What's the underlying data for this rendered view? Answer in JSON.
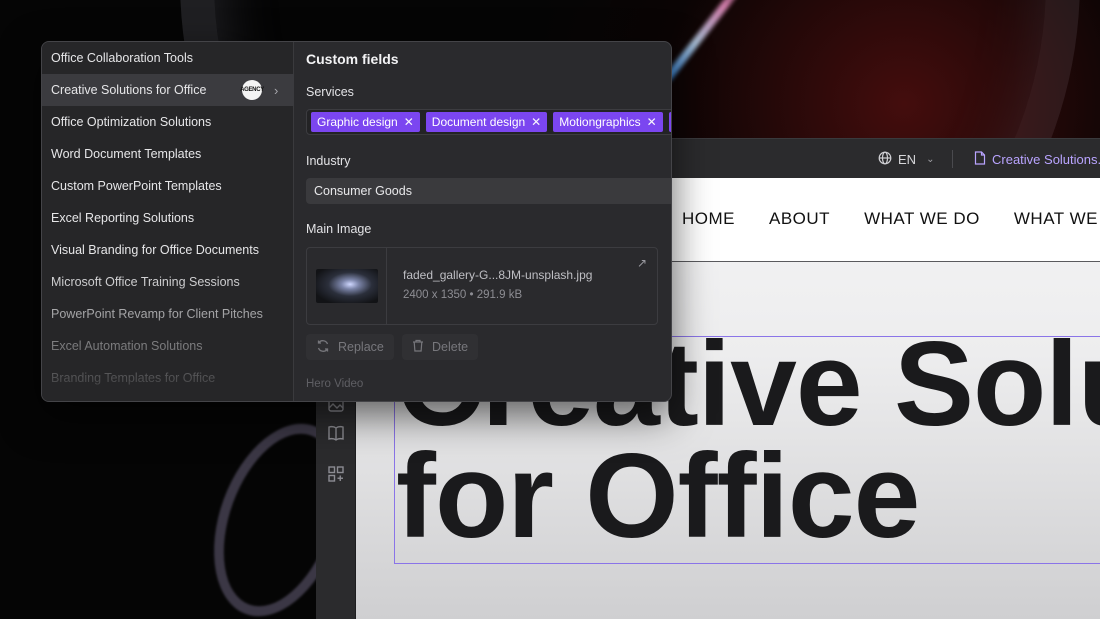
{
  "panel": {
    "list": [
      {
        "label": "Office Collaboration Tools"
      },
      {
        "label": "Creative Solutions for Office",
        "badge": "AGENCY"
      },
      {
        "label": "Office Optimization Solutions"
      },
      {
        "label": "Word Document Templates"
      },
      {
        "label": "Custom PowerPoint Templates"
      },
      {
        "label": "Excel Reporting Solutions"
      },
      {
        "label": "Visual Branding for Office Documents"
      },
      {
        "label": "Microsoft Office Training Sessions"
      },
      {
        "label": "PowerPoint Revamp for Client Pitches"
      },
      {
        "label": "Excel Automation Solutions"
      },
      {
        "label": "Branding Templates for Office"
      }
    ],
    "active_index": 1,
    "fields": {
      "heading": "Custom fields",
      "services_label": "Services",
      "services": [
        "Graphic design",
        "Document design",
        "Motiongraphics",
        "P"
      ],
      "industry_label": "Industry",
      "industry_value": "Consumer Goods",
      "main_image_label": "Main Image",
      "image_name": "faded_gallery-G...8JM-unsplash.jpg",
      "image_meta": "2400 x 1350 • 291.9 kB",
      "replace_label": "Replace",
      "delete_label": "Delete",
      "hero_video_label": "Hero Video"
    }
  },
  "editor": {
    "lang": "EN",
    "page": "Creative Solutions..."
  },
  "site": {
    "nav": [
      "HOME",
      "ABOUT",
      "WHAT WE DO",
      "WHAT WE M"
    ],
    "hero_line1": "Creative Solu",
    "hero_line2": "for Office"
  },
  "colors": {
    "accent": "#7b46f0",
    "crumb": "#b9a4ff"
  }
}
